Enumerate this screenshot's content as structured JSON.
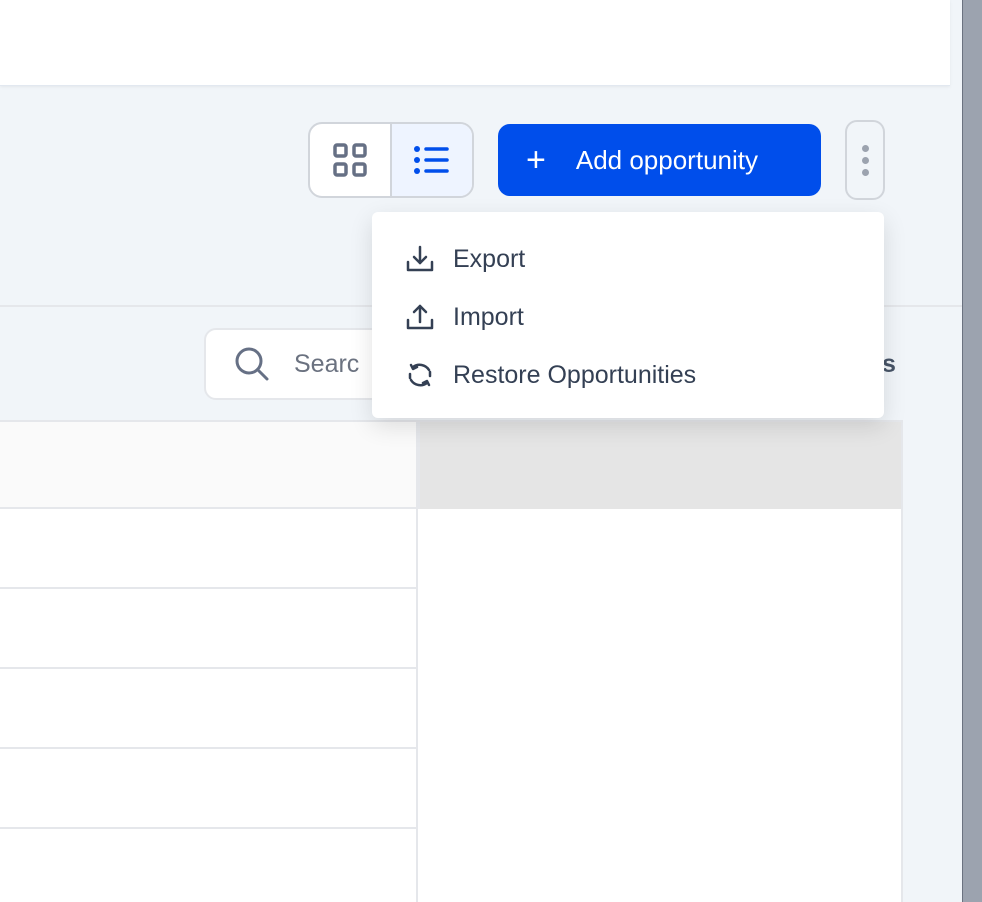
{
  "header": {
    "view_toggle": {
      "grid_icon": "grid-icon",
      "list_icon": "list-icon",
      "active": "list"
    },
    "add_button": {
      "label": "Add opportunity",
      "icon": "plus-icon"
    },
    "more_icon": "vertical-dots-icon",
    "accent": "#004eeb"
  },
  "search": {
    "placeholder": "Searc",
    "icon": "search-icon"
  },
  "toolbar": {
    "partial_text": "s"
  },
  "menu": {
    "items": [
      {
        "label": "Export",
        "icon": "download-icon"
      },
      {
        "label": "Import",
        "icon": "upload-icon"
      },
      {
        "label": "Restore Opportunities",
        "icon": "refresh-icon"
      }
    ]
  }
}
